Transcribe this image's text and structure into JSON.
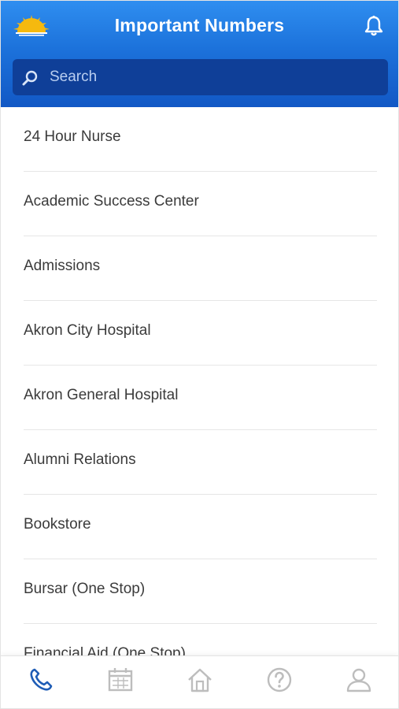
{
  "header": {
    "title": "Important Numbers",
    "logo_icon": "sunrise-logo-icon",
    "bell_icon": "bell-icon",
    "background_color": "#1c72db"
  },
  "search": {
    "placeholder": "Search",
    "icon": "search-icon"
  },
  "contacts": [
    {
      "label": "24 Hour Nurse"
    },
    {
      "label": "Academic Success Center"
    },
    {
      "label": "Admissions"
    },
    {
      "label": "Akron City Hospital"
    },
    {
      "label": "Akron General Hospital"
    },
    {
      "label": "Alumni Relations"
    },
    {
      "label": "Bookstore"
    },
    {
      "label": "Bursar (One Stop)"
    },
    {
      "label": "Financial Aid (One Stop)"
    }
  ],
  "tabs": [
    {
      "name": "phone",
      "icon": "phone-icon",
      "active": true
    },
    {
      "name": "calendar",
      "icon": "calendar-icon",
      "active": false
    },
    {
      "name": "home",
      "icon": "home-icon",
      "active": false
    },
    {
      "name": "help",
      "icon": "help-icon",
      "active": false
    },
    {
      "name": "profile",
      "icon": "profile-icon",
      "active": false
    }
  ],
  "colors": {
    "active_tab": "#1f5db6",
    "inactive_tab": "#bdbdbd",
    "search_bg": "#0f3f98"
  }
}
